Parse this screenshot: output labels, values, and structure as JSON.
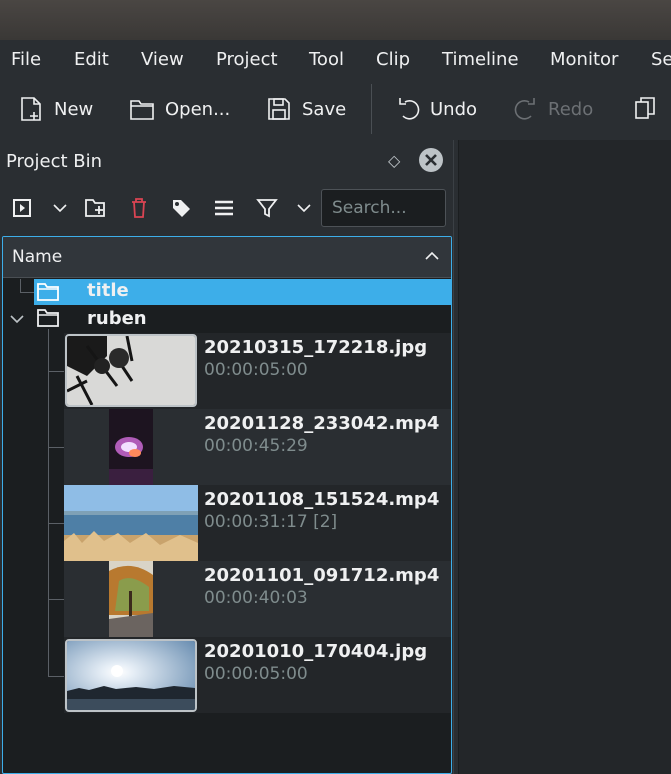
{
  "menu": [
    "File",
    "Edit",
    "View",
    "Project",
    "Tool",
    "Clip",
    "Timeline",
    "Monitor",
    "Se"
  ],
  "toolbar": {
    "new_label": "New",
    "open_label": "Open...",
    "save_label": "Save",
    "undo_label": "Undo",
    "redo_label": "Redo"
  },
  "project_bin": {
    "title": "Project Bin",
    "search_placeholder": "Search...",
    "column_name": "Name",
    "folders": [
      {
        "label": "title",
        "selected": true
      },
      {
        "label": "ruben",
        "expanded": true
      }
    ],
    "clips": [
      {
        "name": "20210315_172218.jpg",
        "duration": "00:00:05:00"
      },
      {
        "name": "20201128_233042.mp4",
        "duration": "00:00:45:29"
      },
      {
        "name": "20201108_151524.mp4",
        "duration": "00:00:31:17 [2]"
      },
      {
        "name": "20201101_091712.mp4",
        "duration": "00:00:40:03"
      },
      {
        "name": "20201010_170404.jpg",
        "duration": "00:00:05:00"
      }
    ],
    "delete_color": "#da4453",
    "selection_color": "#3daee9"
  }
}
